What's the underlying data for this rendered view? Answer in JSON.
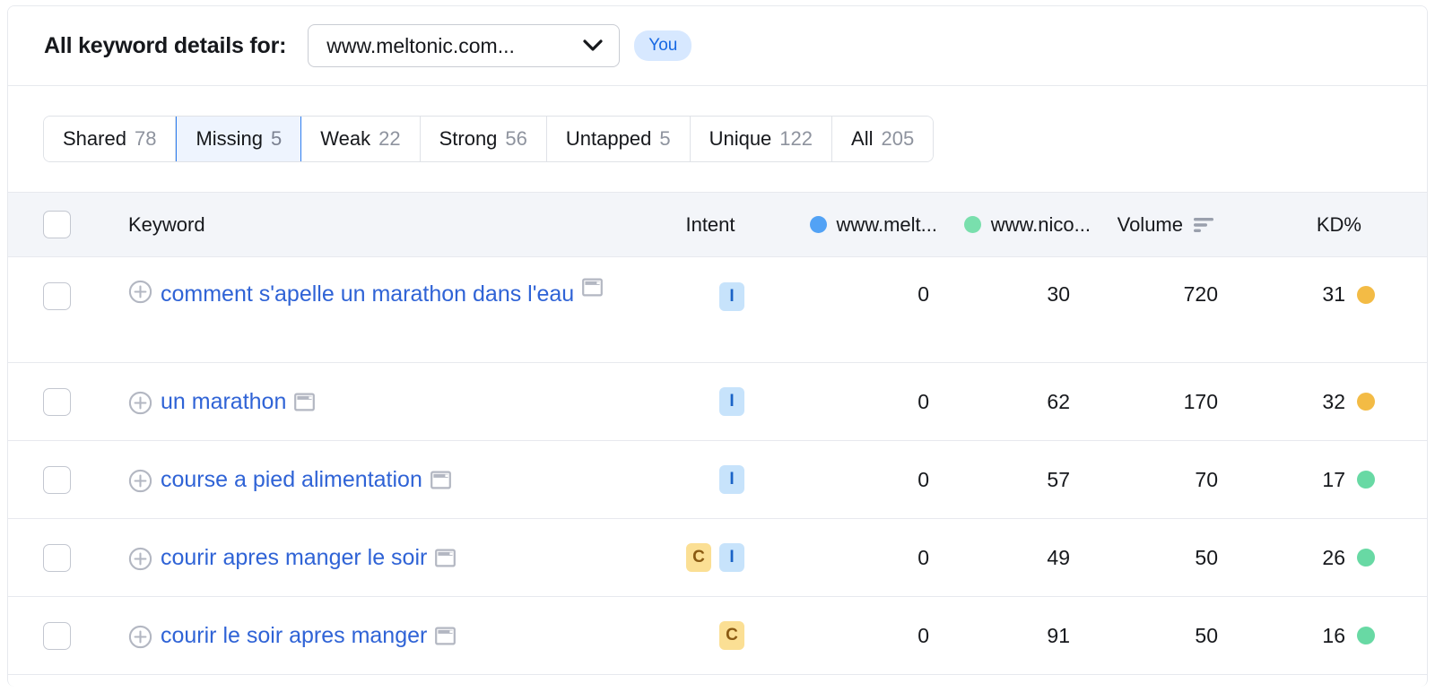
{
  "header": {
    "title": "All keyword details for:",
    "domain_selected": "www.meltonic.com...",
    "you_badge": "You"
  },
  "tabs": [
    {
      "label": "Shared",
      "count": "78",
      "active": false
    },
    {
      "label": "Missing",
      "count": "5",
      "active": true
    },
    {
      "label": "Weak",
      "count": "22",
      "active": false
    },
    {
      "label": "Strong",
      "count": "56",
      "active": false
    },
    {
      "label": "Untapped",
      "count": "5",
      "active": false
    },
    {
      "label": "Unique",
      "count": "122",
      "active": false
    },
    {
      "label": "All",
      "count": "205",
      "active": false
    }
  ],
  "table": {
    "columns": {
      "keyword": "Keyword",
      "intent": "Intent",
      "site1": "www.melt...",
      "site2": "www.nico...",
      "volume": "Volume",
      "kd": "KD%"
    },
    "site1_color": "#52a2f5",
    "site2_color": "#79dfad",
    "site2_highlight": "#e3f8e6",
    "sorted_column": "volume",
    "rows": [
      {
        "keyword": "comment s'apelle un marathon dans l'eau",
        "intent": [
          "I"
        ],
        "site1": "0",
        "site2": "30",
        "volume": "720",
        "kd": "31",
        "kd_color": "#f3bb45"
      },
      {
        "keyword": "un marathon",
        "intent": [
          "I"
        ],
        "site1": "0",
        "site2": "62",
        "volume": "170",
        "kd": "32",
        "kd_color": "#f3bb45"
      },
      {
        "keyword": "course a pied alimentation",
        "intent": [
          "I"
        ],
        "site1": "0",
        "site2": "57",
        "volume": "70",
        "kd": "17",
        "kd_color": "#68d9a4"
      },
      {
        "keyword": "courir apres manger le soir",
        "intent": [
          "C",
          "I"
        ],
        "site1": "0",
        "site2": "49",
        "volume": "50",
        "kd": "26",
        "kd_color": "#68d9a4"
      },
      {
        "keyword": "courir le soir apres manger",
        "intent": [
          "C"
        ],
        "site1": "0",
        "site2": "91",
        "volume": "50",
        "kd": "16",
        "kd_color": "#68d9a4"
      }
    ]
  }
}
